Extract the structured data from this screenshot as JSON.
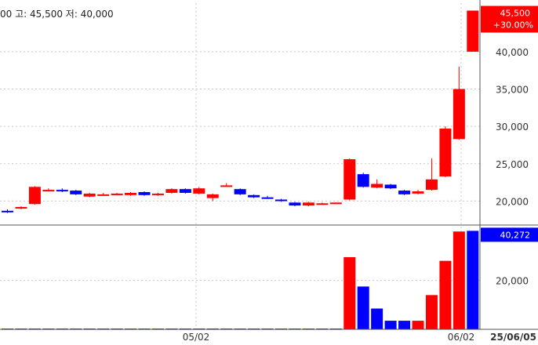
{
  "header": {
    "info_text": "00 고: 45,500 저: 40,000"
  },
  "colors": {
    "up": "#ff0000",
    "down": "#0000ff",
    "grid": "#c8c8c8",
    "axis": "#555555"
  },
  "last_price": {
    "price_label": "45,500",
    "change_label": "+30.00%"
  },
  "last_volume": {
    "label": "40,272"
  },
  "date_footer": "25/06/05",
  "chart_data": [
    {
      "type": "candlestick",
      "panel": "price",
      "ylim": [
        17000,
        46500
      ],
      "yticks": [
        20000,
        25000,
        30000,
        35000,
        40000
      ],
      "ytick_labels": [
        "20,000",
        "25,000",
        "30,000",
        "35,000",
        "40,000"
      ],
      "xticks": [
        "05/02",
        "06/02"
      ],
      "candles": [
        {
          "o": 18700,
          "h": 18900,
          "c": 18500,
          "l": 18400
        },
        {
          "o": 19000,
          "h": 19300,
          "c": 19200,
          "l": 18900
        },
        {
          "o": 19600,
          "h": 22000,
          "c": 21900,
          "l": 19500
        },
        {
          "o": 21500,
          "h": 21700,
          "c": 21500,
          "l": 21300
        },
        {
          "o": 21500,
          "h": 21700,
          "c": 21400,
          "l": 21200
        },
        {
          "o": 21400,
          "h": 21500,
          "c": 20900,
          "l": 20800
        },
        {
          "o": 20600,
          "h": 21100,
          "c": 21000,
          "l": 20500
        },
        {
          "o": 20900,
          "h": 21100,
          "c": 20900,
          "l": 20800
        },
        {
          "o": 20900,
          "h": 21100,
          "c": 21000,
          "l": 20800
        },
        {
          "o": 20800,
          "h": 21200,
          "c": 21100,
          "l": 20700
        },
        {
          "o": 21200,
          "h": 21300,
          "c": 20800,
          "l": 20700
        },
        {
          "o": 20800,
          "h": 21100,
          "c": 21000,
          "l": 20700
        },
        {
          "o": 21100,
          "h": 21700,
          "c": 21600,
          "l": 21000
        },
        {
          "o": 21600,
          "h": 21700,
          "c": 21100,
          "l": 21000
        },
        {
          "o": 21000,
          "h": 21900,
          "c": 21700,
          "l": 20900
        },
        {
          "o": 20400,
          "h": 21000,
          "c": 20900,
          "l": 20000
        },
        {
          "o": 22100,
          "h": 22400,
          "c": 22100,
          "l": 22000
        },
        {
          "o": 21600,
          "h": 21700,
          "c": 20900,
          "l": 20800
        },
        {
          "o": 20800,
          "h": 20900,
          "c": 20500,
          "l": 20400
        },
        {
          "o": 20500,
          "h": 20700,
          "c": 20400,
          "l": 20300
        },
        {
          "o": 20200,
          "h": 20300,
          "c": 20000,
          "l": 19900
        },
        {
          "o": 19800,
          "h": 19900,
          "c": 19400,
          "l": 19300
        },
        {
          "o": 19400,
          "h": 19900,
          "c": 19800,
          "l": 19300
        },
        {
          "o": 19700,
          "h": 19800,
          "c": 19700,
          "l": 19600
        },
        {
          "o": 19700,
          "h": 19800,
          "c": 19800,
          "l": 19600
        },
        {
          "o": 20200,
          "h": 25700,
          "c": 25600,
          "l": 20100
        },
        {
          "o": 23600,
          "h": 23800,
          "c": 21900,
          "l": 21800
        },
        {
          "o": 21800,
          "h": 22900,
          "c": 22300,
          "l": 21700
        },
        {
          "o": 22200,
          "h": 22300,
          "c": 21700,
          "l": 21600
        },
        {
          "o": 21400,
          "h": 21500,
          "c": 20900,
          "l": 20800
        },
        {
          "o": 21000,
          "h": 21500,
          "c": 21300,
          "l": 20900
        },
        {
          "o": 21500,
          "h": 25700,
          "c": 22900,
          "l": 21400
        },
        {
          "o": 23300,
          "h": 30000,
          "c": 29700,
          "l": 23200
        },
        {
          "o": 28300,
          "h": 38000,
          "c": 35000,
          "l": 28200
        },
        {
          "o": 40000,
          "h": 45500,
          "c": 45500,
          "l": 40000
        }
      ]
    },
    {
      "type": "bar",
      "panel": "volume",
      "ylim": [
        0,
        42000
      ],
      "yticks": [
        20000
      ],
      "ytick_labels": [
        "20,000"
      ],
      "values": [
        300,
        300,
        300,
        300,
        300,
        300,
        300,
        300,
        300,
        300,
        300,
        300,
        300,
        300,
        300,
        300,
        300,
        300,
        300,
        300,
        300,
        300,
        300,
        300,
        300,
        29500,
        17500,
        8500,
        3500,
        3500,
        3500,
        14000,
        28000,
        40000,
        40272
      ],
      "colors": [
        "down",
        "down",
        "down",
        "down",
        "down",
        "down",
        "down",
        "down",
        "down",
        "down",
        "down",
        "down",
        "down",
        "down",
        "down",
        "down",
        "down",
        "down",
        "down",
        "down",
        "down",
        "down",
        "down",
        "down",
        "down",
        "up",
        "down",
        "down",
        "down",
        "down",
        "up",
        "up",
        "up",
        "up",
        "down"
      ]
    }
  ]
}
